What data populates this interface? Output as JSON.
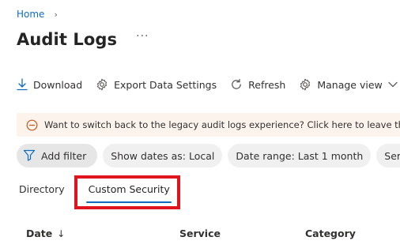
{
  "breadcrumb": {
    "home": "Home",
    "separator": "›"
  },
  "page": {
    "title": "Audit Logs",
    "more": "···"
  },
  "toolbar": {
    "download": "Download",
    "export": "Export Data Settings",
    "refresh": "Refresh",
    "manage_view": "Manage view"
  },
  "banner": {
    "text": "Want to switch back to the legacy audit logs experience? Click here to leave the previ"
  },
  "filters": {
    "add_filter": "Add filter",
    "show_dates": "Show dates as: Local",
    "date_range": "Date range: Last 1 month",
    "service_partial": "Serv"
  },
  "tabs": {
    "directory": "Directory",
    "custom_security": "Custom Security"
  },
  "table": {
    "columns": {
      "date": "Date",
      "date_sort": "↓",
      "service": "Service",
      "category": "Category"
    }
  },
  "colors": {
    "accent": "#0f6cbd",
    "highlight": "#e0141e",
    "banner_bg": "#fdf3ed",
    "warning": "#c25a1c"
  }
}
